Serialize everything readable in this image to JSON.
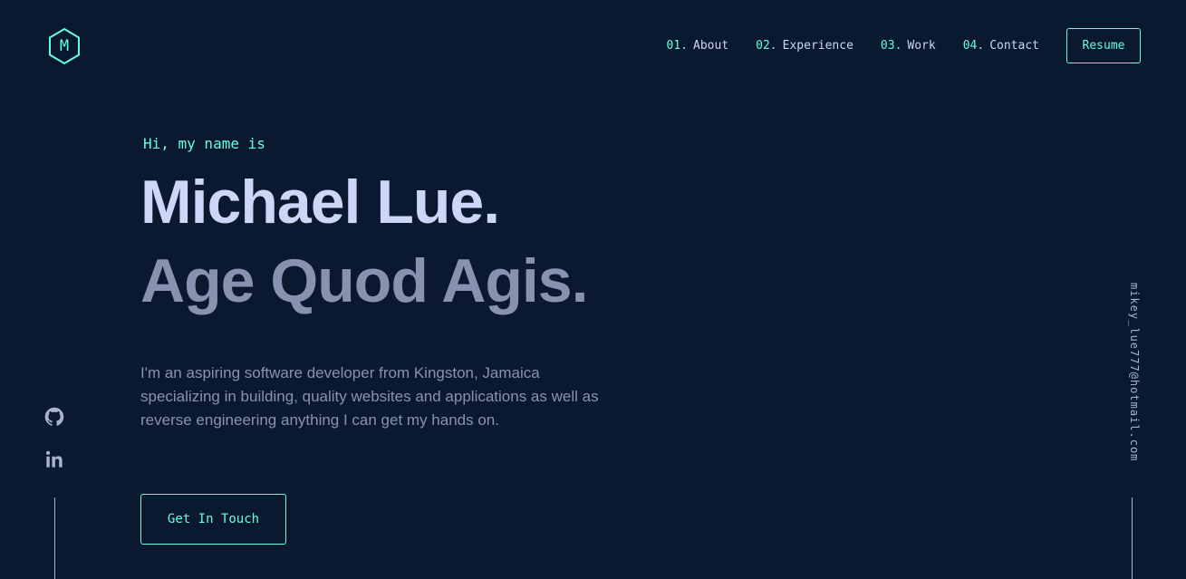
{
  "logo": {
    "letter": "M",
    "icon": "hexagon-logo-icon"
  },
  "nav": {
    "items": [
      {
        "num": "01.",
        "label": "About"
      },
      {
        "num": "02.",
        "label": "Experience"
      },
      {
        "num": "03.",
        "label": "Work"
      },
      {
        "num": "04.",
        "label": "Contact"
      }
    ],
    "resume_label": "Resume"
  },
  "hero": {
    "greeting": "Hi, my name is",
    "name": "Michael Lue.",
    "motto": "Age Quod Agis.",
    "description": "I'm an aspiring software developer from Kingston, Jamaica specializing in building, quality websites and applications as well as reverse engineering anything I can get my hands on.",
    "cta_label": "Get In Touch"
  },
  "social": [
    {
      "icon": "github-icon"
    },
    {
      "icon": "linkedin-icon"
    }
  ],
  "email": "mikey_lue777@hotmail.com",
  "colors": {
    "background": "#0a192f",
    "accent": "#64ffda",
    "heading": "#ccd6f6",
    "muted": "#8892b0"
  }
}
